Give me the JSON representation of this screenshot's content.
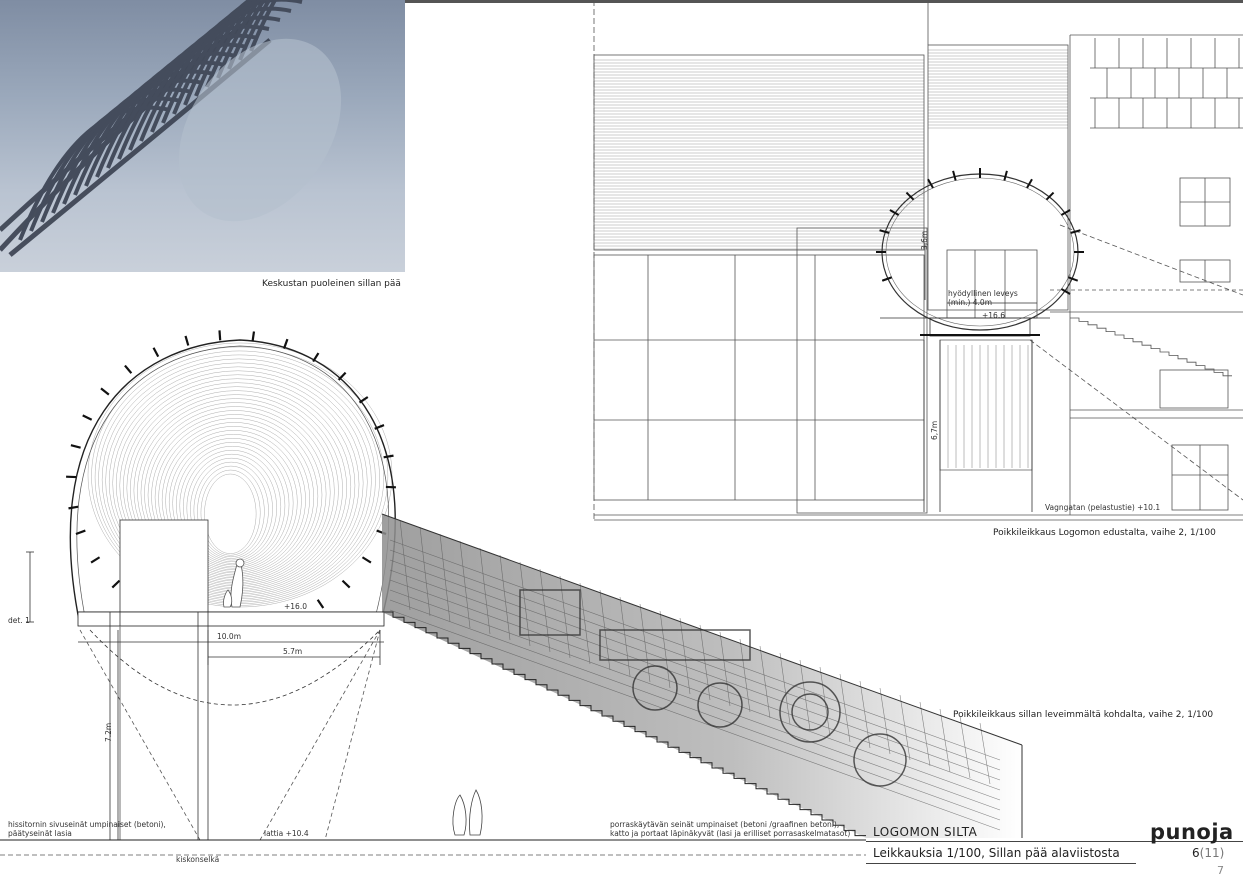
{
  "render": {
    "caption": "Keskustan puoleinen sillan pää"
  },
  "elevation": {
    "caption": "Poikkileikkaus Logomon edustalta, vaihe 2, 1/100",
    "labels": {
      "clear_width": "hyödyllinen leveys\n(min.) 4.0m",
      "level_top": "+16.6",
      "street": "Vagngatan (pelastustie) +10.1",
      "height_small": "3,6m",
      "height": "6,7m"
    }
  },
  "section": {
    "caption": "Poikkileikkaus sillan leveimmältä kohdalta, vaihe 2, 1/100",
    "labels": {
      "deck_level": "+16.0",
      "width_total": "10.0m",
      "width_half": "5.7m",
      "height": "7.2m",
      "detail": "det. 1",
      "ground_level": "lattia +10.4",
      "track": "kiskonselkä",
      "note_left": "hissitornin sivuseinät umpinaiset (betoni),\npäätyseinät lasia",
      "note_right": "porraskäytävän seinät umpinaiset (betoni /graafinen betoni),\nkatto ja portaat läpinäkyvät (lasi ja erilliset porrasaskelmatasot)"
    }
  },
  "title_block": {
    "project": "LOGOMON SILTA",
    "subtitle": "Leikkauksia 1/100, Sillan pää alaviistosta",
    "brand": "punoja",
    "page": "6",
    "page_total": "(11)",
    "sheet": "7"
  }
}
